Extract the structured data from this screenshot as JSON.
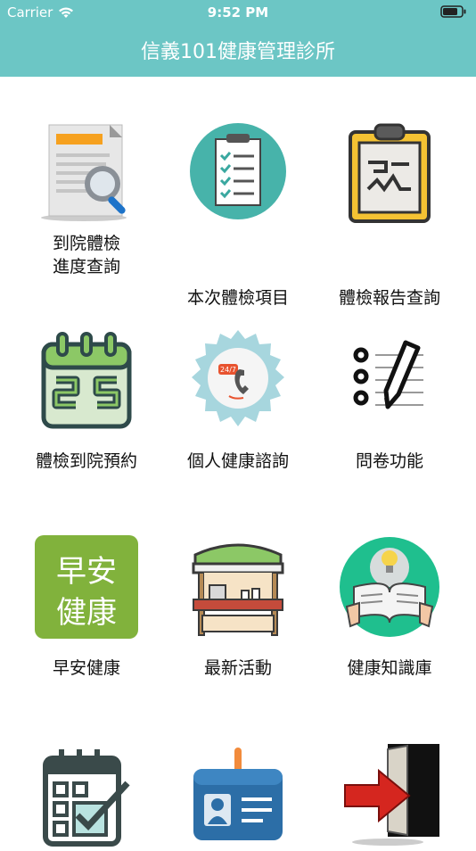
{
  "status_bar": {
    "carrier": "Carrier",
    "time": "9:52 PM"
  },
  "header": {
    "title": "信義101健康管理診所"
  },
  "menu": [
    {
      "label": "到院體檢\n進度查詢",
      "icon": "document-search-icon"
    },
    {
      "label": "本次體檢項目",
      "icon": "checklist-clipboard-icon"
    },
    {
      "label": "體檢報告查詢",
      "icon": "report-clipboard-icon"
    },
    {
      "label": "體檢到院預約",
      "icon": "calendar-25-icon"
    },
    {
      "label": "個人健康諮詢",
      "icon": "phone-24-7-icon"
    },
    {
      "label": "問卷功能",
      "icon": "questionnaire-pen-icon"
    },
    {
      "label": "早安健康",
      "icon": "morning-health-logo-icon",
      "logo_text": [
        "早安",
        "健康"
      ]
    },
    {
      "label": "最新活動",
      "icon": "market-stall-icon"
    },
    {
      "label": "健康知識庫",
      "icon": "reading-book-idea-icon"
    },
    {
      "label": "",
      "icon": "calendar-check-icon"
    },
    {
      "label": "",
      "icon": "id-card-icon"
    },
    {
      "label": "",
      "icon": "exit-door-icon"
    }
  ]
}
